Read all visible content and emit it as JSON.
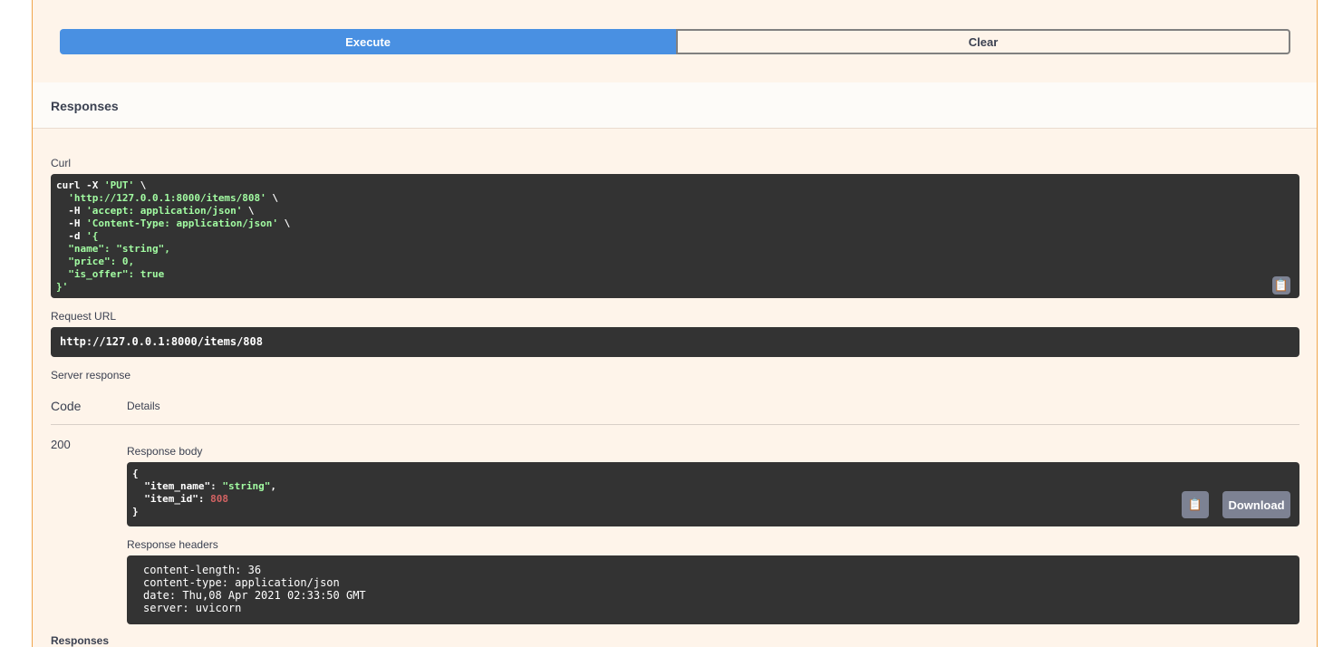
{
  "buttons": {
    "execute": "Execute",
    "clear": "Clear",
    "download": "Download"
  },
  "responses_title": "Responses",
  "curl": {
    "label": "Curl",
    "line1_cmd": "curl -X ",
    "line1_method": "'PUT'",
    "line1_end": " \\",
    "line2": "'http://127.0.0.1:8000/items/808'",
    "line3a": "-H ",
    "line3": "'accept: application/json'",
    "line4": "'Content-Type: application/json'",
    "line5a": "-d ",
    "line5": "'{",
    "line6": "\"name\": \"string\",",
    "line7": "\"price\": 0,",
    "line8": "\"is_offer\": true",
    "line9": "}'"
  },
  "request_url": {
    "label": "Request URL",
    "value": "http://127.0.0.1:8000/items/808"
  },
  "server_response": {
    "label": "Server response",
    "code_header": "Code",
    "details_header": "Details",
    "code": "200",
    "body_label": "Response body",
    "body_open": "{",
    "body_key1": "\"item_name\"",
    "body_val1": "\"string\"",
    "body_key2": "\"item_id\"",
    "body_val2": "808",
    "body_close": "}",
    "headers_label": "Response headers",
    "headers": [
      "content-length: 36",
      "content-type: application/json",
      "date: Thu,08 Apr 2021 02:33:50 GMT",
      "server: uvicorn"
    ]
  },
  "responses_bottom": "Responses"
}
